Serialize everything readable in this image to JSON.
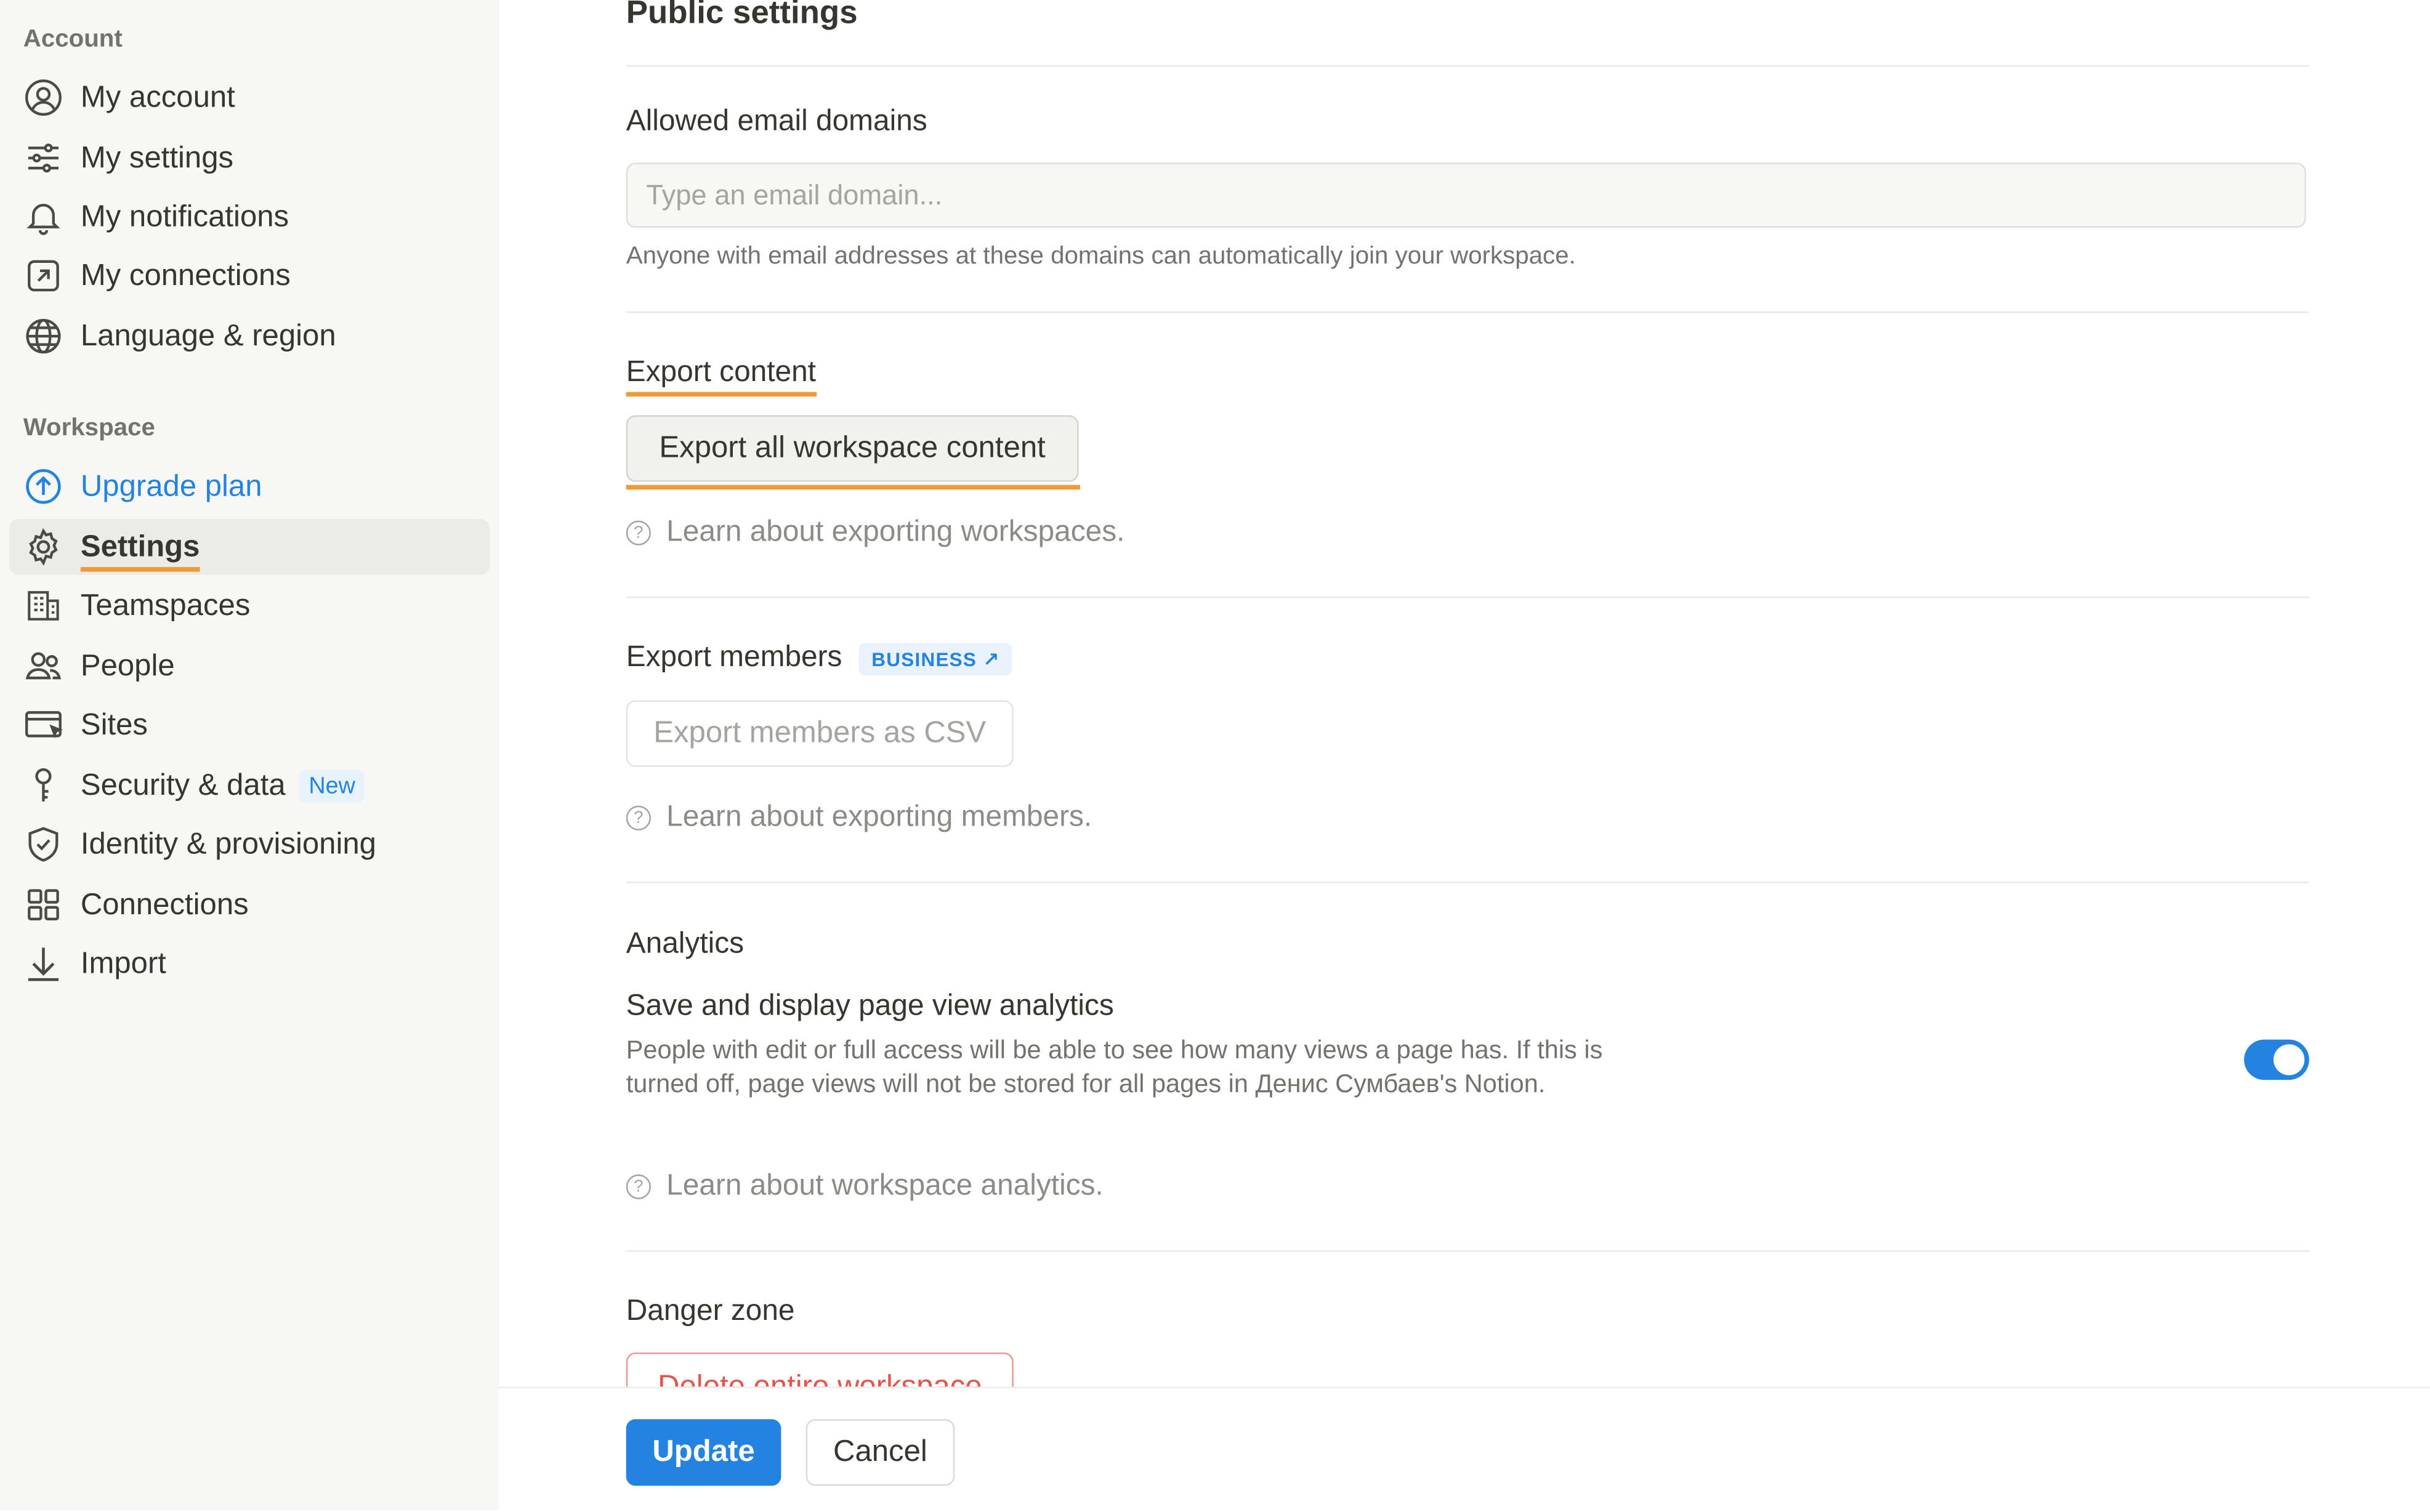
{
  "sidebar": {
    "account_label": "Account",
    "workspace_label": "Workspace",
    "account_items": [
      {
        "label": "My account",
        "icon": "user-circle-icon"
      },
      {
        "label": "My settings",
        "icon": "sliders-icon"
      },
      {
        "label": "My notifications",
        "icon": "bell-icon"
      },
      {
        "label": "My connections",
        "icon": "external-link-box-icon"
      },
      {
        "label": "Language & region",
        "icon": "globe-icon"
      }
    ],
    "workspace_items": [
      {
        "label": "Upgrade plan",
        "icon": "arrow-up-circle-icon"
      },
      {
        "label": "Settings",
        "icon": "gear-icon",
        "active": true
      },
      {
        "label": "Teamspaces",
        "icon": "building-icon"
      },
      {
        "label": "People",
        "icon": "people-icon"
      },
      {
        "label": "Sites",
        "icon": "browser-cursor-icon"
      },
      {
        "label": "Security & data",
        "icon": "key-icon",
        "badge": "New"
      },
      {
        "label": "Identity & provisioning",
        "icon": "shield-check-icon"
      },
      {
        "label": "Connections",
        "icon": "grid-icon"
      },
      {
        "label": "Import",
        "icon": "download-arrow-icon"
      }
    ]
  },
  "main": {
    "public_settings_title": "Public settings",
    "email_domains": {
      "title": "Allowed email domains",
      "placeholder": "Type an email domain...",
      "value": "",
      "hint": "Anyone with email addresses at these domains can automatically join your workspace."
    },
    "export_content": {
      "title": "Export content",
      "button": "Export all workspace content",
      "learn": "Learn about exporting workspaces."
    },
    "export_members": {
      "title": "Export members",
      "badge": "BUSINESS ↗",
      "button": "Export members as CSV",
      "learn": "Learn about exporting members."
    },
    "analytics": {
      "title": "Analytics",
      "setting_title": "Save and display page view analytics",
      "description": "People with edit or full access will be able to see how many views a page has. If this is turned off, page views will not be stored for all pages in Денис Сумбаев's Notion.",
      "toggle_on": true,
      "learn": "Learn about workspace analytics."
    },
    "danger_zone": {
      "title": "Danger zone",
      "button": "Delete entire workspace"
    }
  },
  "footer": {
    "update": "Update",
    "cancel": "Cancel"
  },
  "colors": {
    "accent": "#2383e2",
    "highlight_underline": "#f29a38",
    "danger": "#e5534b",
    "sidebar_bg": "#f7f7f5"
  }
}
